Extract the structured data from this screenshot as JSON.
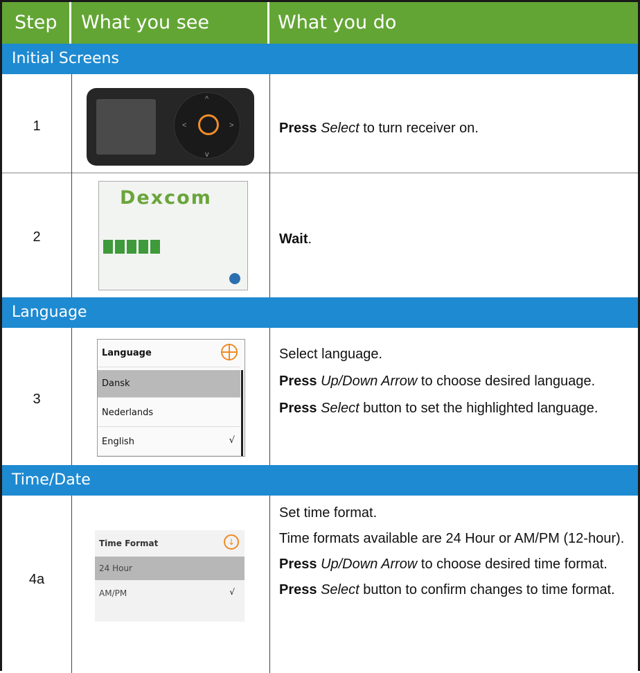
{
  "header": {
    "col_step": "Step",
    "col_see": "What you see",
    "col_do": "What you do"
  },
  "sections": {
    "initial": "Initial Screens",
    "language": "Language",
    "timedate": "Time/Date"
  },
  "rows": {
    "r1": {
      "step": "1",
      "press": "Press",
      "select": "Select",
      "rest": " to turn receiver on."
    },
    "r2": {
      "step": "2",
      "logo": "Dexcom",
      "wait": "Wait",
      "period": "."
    },
    "r3": {
      "step": "3",
      "screen": {
        "title": "Language",
        "items": [
          "Dansk",
          "Nederlands",
          "English"
        ],
        "check": "√"
      },
      "p1": "Select language.",
      "p2_press": "Press",
      "p2_italic": "Up/Down Arrow",
      "p2_rest": " to choose desired language.",
      "p3_press": "Press",
      "p3_italic": "Select",
      "p3_rest": " button to set the highlighted language."
    },
    "r4a": {
      "step": "4a",
      "screen": {
        "title": "Time Format",
        "items": [
          "24 Hour",
          "AM/PM"
        ],
        "check": "√"
      },
      "p1": "Set time format.",
      "p2": "Time formats available are 24 Hour or AM/PM (12-hour).",
      "p3_press": "Press",
      "p3_italic": "Up/Down Arrow",
      "p3_rest": " to choose desired time format.",
      "p4_press": "Press",
      "p4_italic": "Select",
      "p4_rest": " button to confirm changes to time format."
    }
  },
  "colors": {
    "header_green": "#63a534",
    "section_blue": "#1e8ad1",
    "accent_orange": "#ef8a25"
  }
}
